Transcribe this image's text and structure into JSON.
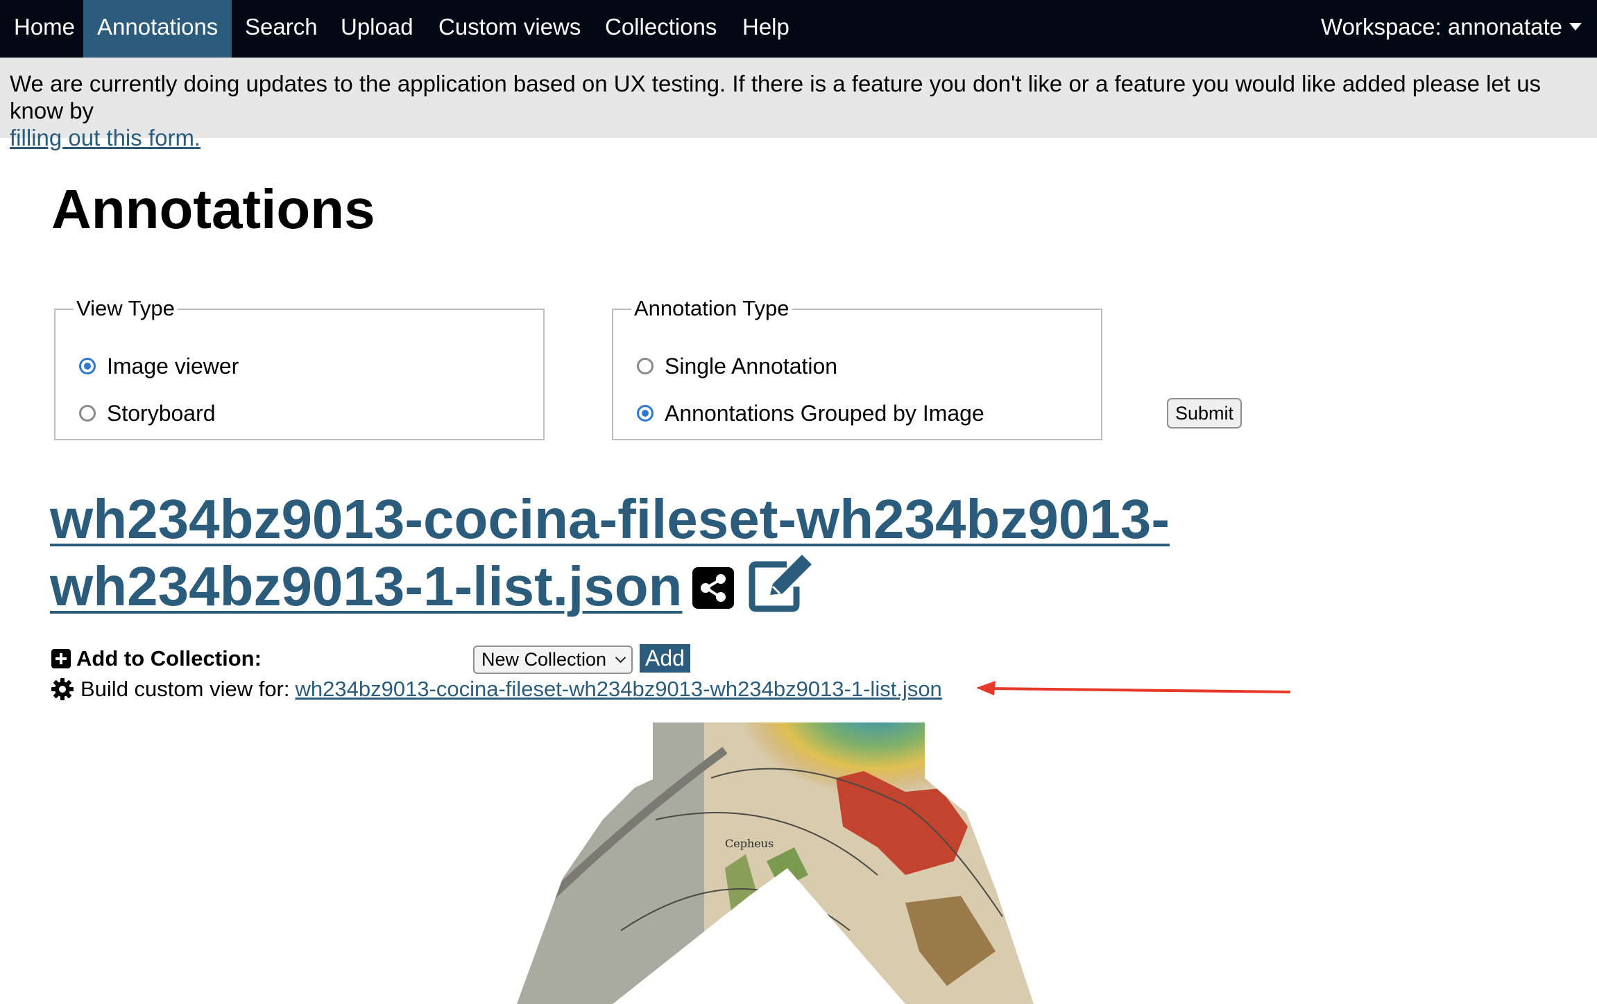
{
  "nav": {
    "items": [
      {
        "label": "Home",
        "active": false
      },
      {
        "label": "Annotations",
        "active": true
      },
      {
        "label": "Search",
        "active": false
      },
      {
        "label": "Upload",
        "active": false
      },
      {
        "label": "Custom views",
        "active": false
      },
      {
        "label": "Collections",
        "active": false
      },
      {
        "label": "Help",
        "active": false
      }
    ],
    "workspace_label": "Workspace: annonatate"
  },
  "banner": {
    "text": "We are currently doing updates to the application based on UX testing. If there is a feature you don't like or a feature you would like added please let us know by",
    "link_text": "filling out this form."
  },
  "page_title": "Annotations",
  "view_type": {
    "legend": "View Type",
    "options": [
      {
        "label": "Image viewer",
        "checked": true
      },
      {
        "label": "Storyboard",
        "checked": false
      }
    ]
  },
  "annotation_type": {
    "legend": "Annotation Type",
    "options": [
      {
        "label": "Single Annotation",
        "checked": false
      },
      {
        "label": "Annontations Grouped by Image",
        "checked": true
      }
    ]
  },
  "submit_label": "Submit",
  "file_title": {
    "line1": "wh234bz9013-cocina-fileset-wh234bz9013-",
    "line2": "wh234bz9013-1-list.json"
  },
  "add_to_collection": {
    "label": "Add to Collection:",
    "selected": "New Collection",
    "add_label": "Add"
  },
  "custom_view": {
    "label": "Build custom view for:",
    "link_text": "wh234bz9013-cocina-fileset-wh234bz9013-wh234bz9013-1-list.json"
  },
  "map_labels": {
    "cepheus": "Cepheus"
  },
  "colors": {
    "nav_bg": "#030914",
    "accent": "#2c5c7b",
    "banner_bg": "#e7e7e7",
    "arrow": "#e5392a",
    "radio_checked": "#2f77d6"
  },
  "icons": [
    "caret-down-icon",
    "plus-square-icon",
    "share-icon",
    "edit-icon",
    "gear-icon"
  ]
}
